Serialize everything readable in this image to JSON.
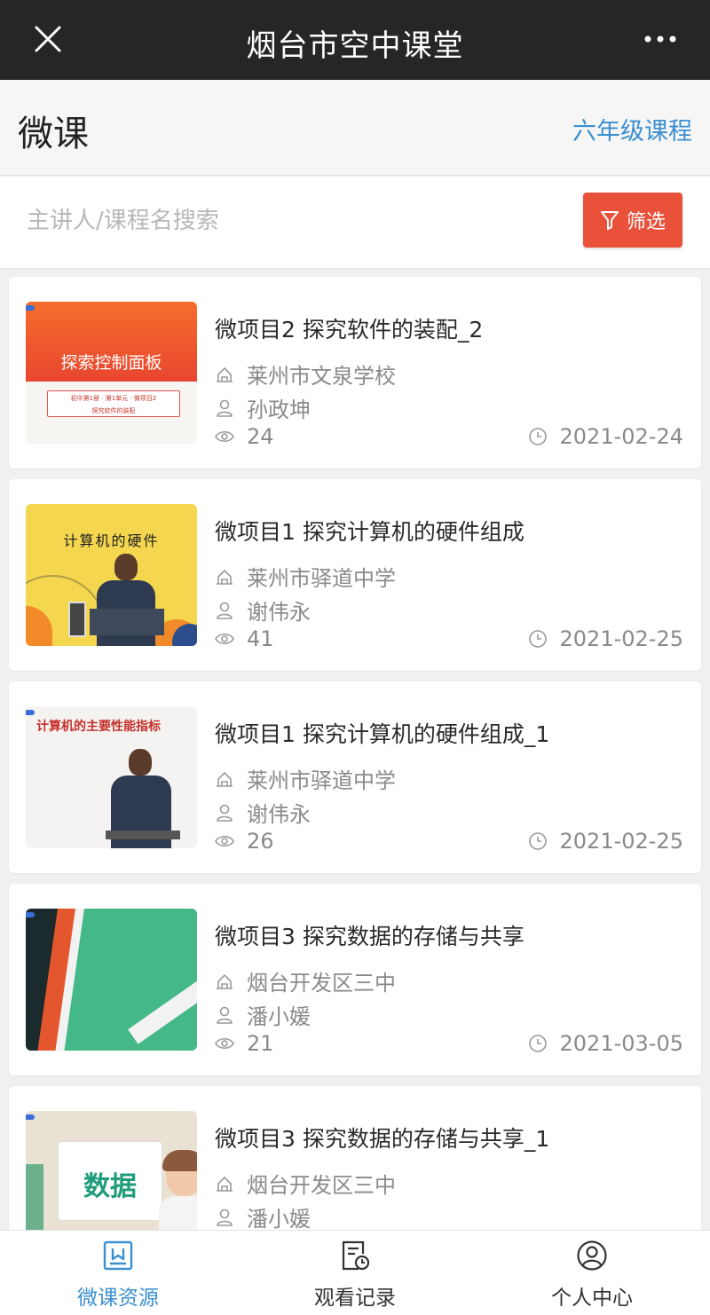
{
  "app": {
    "title": "烟台市空中课堂"
  },
  "header": {
    "title": "微课",
    "grade_link": "六年级课程"
  },
  "search": {
    "placeholder": "主讲人/课程名搜索",
    "filter_label": "筛选"
  },
  "courses": [
    {
      "title": "微项目2 探究软件的装配_2",
      "school": "莱州市文泉学校",
      "teacher": "孙政坤",
      "views": "24",
      "date": "2021-02-24",
      "thumb_text": "探索控制面板",
      "thumb_sub1": "初中第1册 · 第1单元 · 微项目2",
      "thumb_sub2": "探究软件的装配"
    },
    {
      "title": "微项目1 探究计算机的硬件组成",
      "school": "莱州市驿道中学",
      "teacher": "谢伟永",
      "views": "41",
      "date": "2021-02-25",
      "thumb_text": "计算机的硬件"
    },
    {
      "title": "微项目1 探究计算机的硬件组成_1",
      "school": "莱州市驿道中学",
      "teacher": "谢伟永",
      "views": "26",
      "date": "2021-02-25",
      "thumb_text": "计算机的主要性能指标"
    },
    {
      "title": "微项目3 探究数据的存储与共享",
      "school": "烟台开发区三中",
      "teacher": "潘小媛",
      "views": "21",
      "date": "2021-03-05"
    },
    {
      "title": "微项目3 探究数据的存储与共享_1",
      "school": "烟台开发区三中",
      "teacher": "潘小媛",
      "thumb_text": "数据"
    }
  ],
  "tabs": [
    {
      "label": "微课资源",
      "icon": "course-resource-icon",
      "active": true
    },
    {
      "label": "观看记录",
      "icon": "history-icon",
      "active": false
    },
    {
      "label": "个人中心",
      "icon": "user-icon",
      "active": false
    }
  ],
  "colors": {
    "topbar": "#262626",
    "accent": "#3a8fd0",
    "filter_button": "#e9513b"
  }
}
